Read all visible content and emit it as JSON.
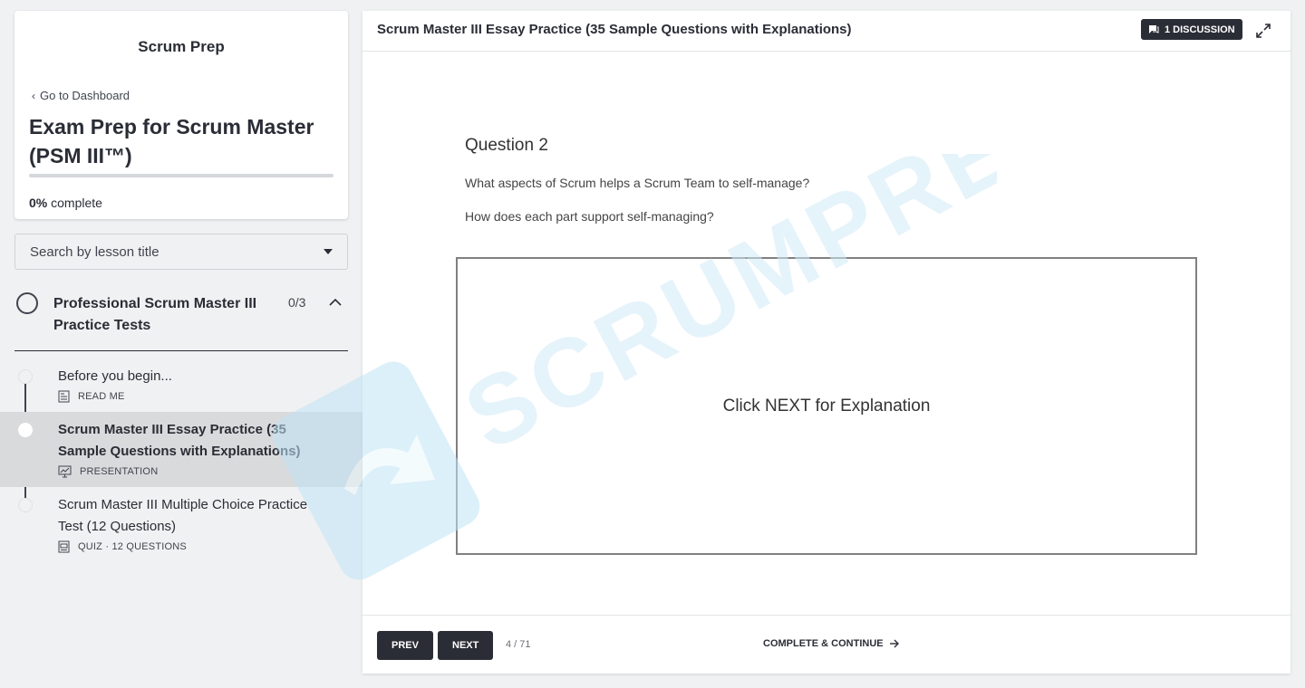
{
  "sidebar": {
    "brand": "Scrum Prep",
    "back_link": "Go to Dashboard",
    "course_title": "Exam Prep for Scrum Master (PSM III™)",
    "progress": {
      "fraction": 0,
      "percent_label": "0%",
      "suffix": " complete"
    },
    "search": {
      "placeholder": "Search by lesson title"
    },
    "chapter": {
      "title": "Professional Scrum Master III Practice Tests",
      "count": "0/3",
      "expanded": true
    },
    "lessons": [
      {
        "title": "Before you begin...",
        "type": "READ ME",
        "icon": "document-icon",
        "active": false
      },
      {
        "title": "Scrum Master III Essay Practice (35 Sample Questions with Explanations)",
        "type": "PRESENTATION",
        "icon": "presentation-icon",
        "active": true
      },
      {
        "title": "Scrum Master III Multiple Choice Practice Test (12 Questions)",
        "type": "QUIZ · 12 QUESTIONS",
        "icon": "quiz-icon",
        "active": false
      }
    ]
  },
  "watermark": {
    "text": "SCRUMPREP",
    "color": "#cfe9f8"
  },
  "main": {
    "title": "Scrum Master III Essay Practice (35 Sample Questions with Explanations)",
    "discussion_label": "1 DISCUSSION",
    "slide": {
      "question_title": "Question 2",
      "line1": "What aspects of Scrum helps a Scrum Team to self-manage?",
      "line2": "How does each part support self-managing?",
      "answer_prompt": "Click NEXT for Explanation"
    },
    "footer": {
      "prev_label": "PREV",
      "next_label": "NEXT",
      "page_count": "4 / 71",
      "complete_label": "COMPLETE & CONTINUE"
    }
  },
  "colors": {
    "accent": "#2b2d36",
    "sidebar_bg": "#f0f1f2",
    "active_row": "#d9dadc"
  }
}
